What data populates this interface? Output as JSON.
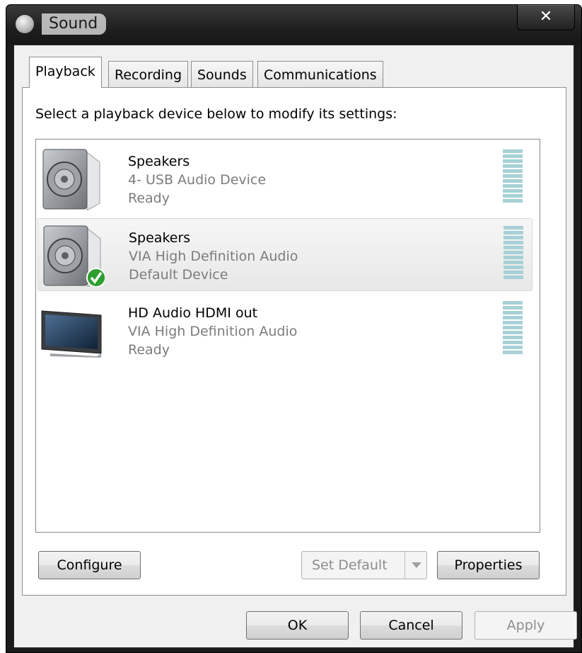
{
  "window": {
    "title": "Sound",
    "close_glyph": "✕"
  },
  "tabs": [
    {
      "label": "Playback",
      "active": true
    },
    {
      "label": "Recording",
      "active": false
    },
    {
      "label": "Sounds",
      "active": false
    },
    {
      "label": "Communications",
      "active": false
    }
  ],
  "instruction": "Select a playback device below to modify its settings:",
  "devices": [
    {
      "name": "Speakers",
      "description": "4- USB Audio Device",
      "status": "Ready",
      "icon": "speaker-icon",
      "selected": false,
      "default": false
    },
    {
      "name": "Speakers",
      "description": "VIA High Definition Audio",
      "status": "Default Device",
      "icon": "speaker-icon",
      "selected": true,
      "default": true
    },
    {
      "name": "HD Audio HDMI out",
      "description": "VIA High Definition Audio",
      "status": "Ready",
      "icon": "monitor-icon",
      "selected": false,
      "default": false
    }
  ],
  "panel_buttons": {
    "configure": "Configure",
    "set_default": "Set Default",
    "properties": "Properties"
  },
  "dialog_buttons": {
    "ok": "OK",
    "cancel": "Cancel",
    "apply": "Apply"
  },
  "colors": {
    "meter": "#a7d1d6",
    "default_check": "#2e9e2e",
    "titlebar": "#1f1f1f"
  }
}
